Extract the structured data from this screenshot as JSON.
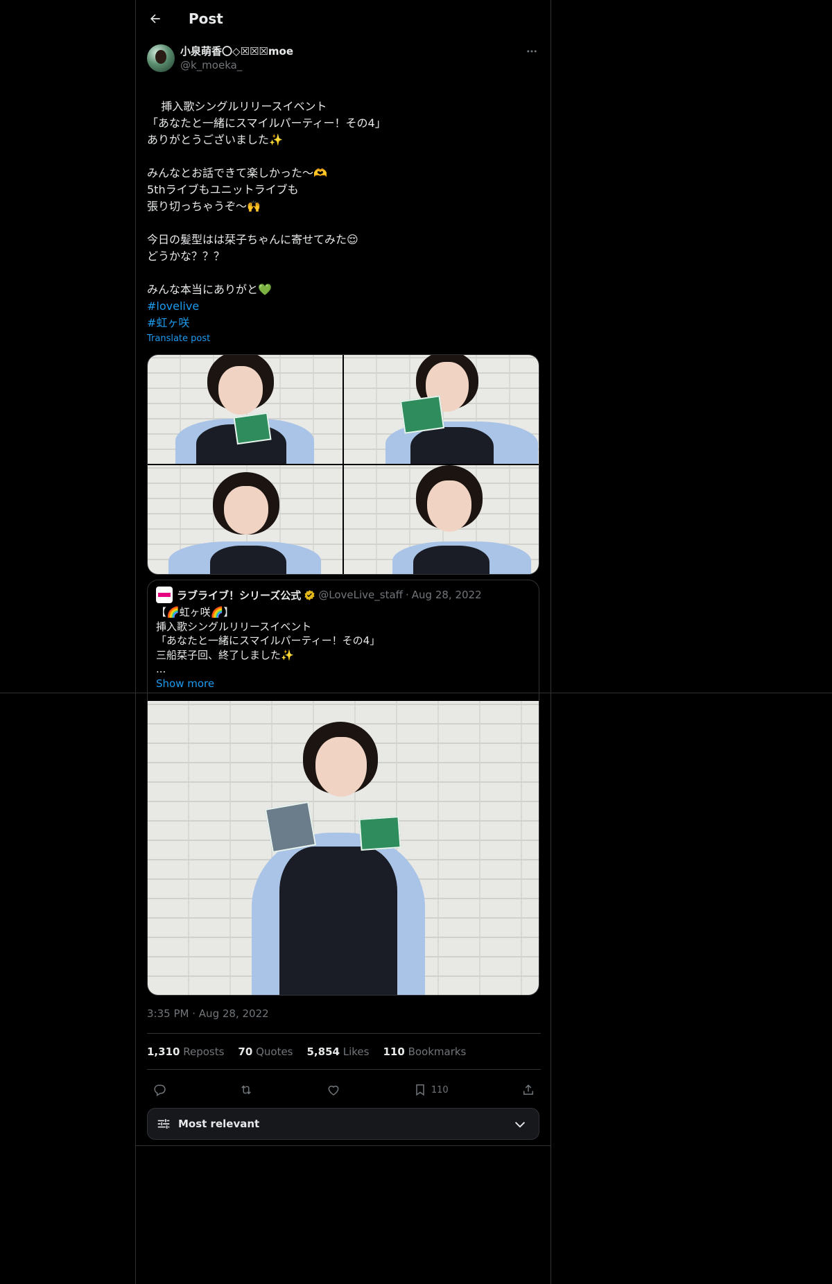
{
  "header": {
    "title": "Post"
  },
  "author": {
    "display_name": "小泉萌香〇◇☒☒☒moe",
    "handle": "@k_moeka_"
  },
  "tweet": {
    "text": "挿入歌シングルリリースイベント\n「あなたと一緒にスマイルパーティー！その4」\nありがとうございました✨\n\nみんなとお話できて楽しかった〜🫶\n5thライブもユニットライブも\n張り切っちゃうぞ〜🙌\n\n今日の髪型はは栞子ちゃんに寄せてみた😌\nどうかな？？？\n\nみんな本当にありがと💚\n",
    "hashtags": [
      "#lovelive",
      "#虹ヶ咲"
    ],
    "translate_label": "Translate post"
  },
  "quote": {
    "name": "ラブライブ！シリーズ公式",
    "handle": "@LoveLive_staff",
    "separator": "·",
    "date": "Aug 28, 2022",
    "text": "【🌈虹ヶ咲🌈】\n挿入歌シングルリリースイベント\n「あなたと一緒にスマイルパーティー！その4」\n三船栞子回、終了しました✨\n...",
    "show_more": "Show more"
  },
  "meta": {
    "time": "3:35 PM",
    "separator": "·",
    "date": "Aug 28, 2022"
  },
  "stats": {
    "reposts_count": "1,310",
    "reposts_label": "Reposts",
    "quotes_count": "70",
    "quotes_label": "Quotes",
    "likes_count": "5,854",
    "likes_label": "Likes",
    "bookmarks_count": "110",
    "bookmarks_label": "Bookmarks"
  },
  "actions": {
    "bookmark_count": "110"
  },
  "sort": {
    "label": "Most relevant"
  },
  "colors": {
    "accent": "#1d9bf0",
    "muted": "#71767b",
    "text": "#e7e9ea",
    "border": "#2f3336",
    "verified": "#e2b719"
  },
  "icons": [
    "back-arrow-icon",
    "more-icon",
    "verified-icon",
    "reply-icon",
    "repost-icon",
    "like-icon",
    "bookmark-icon",
    "share-icon",
    "sliders-icon",
    "chevron-down-icon"
  ]
}
